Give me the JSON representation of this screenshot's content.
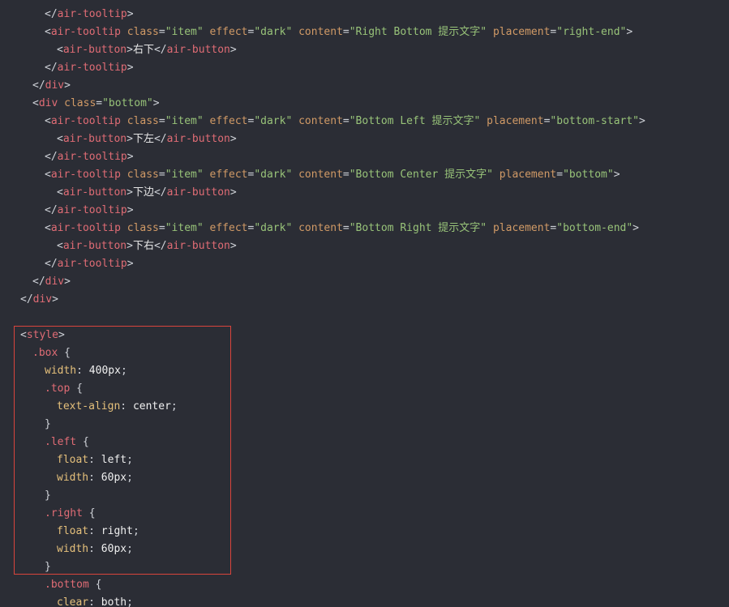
{
  "colors": {
    "background": "#2b2d35",
    "punct": "#cfd2d8",
    "tag": "#e06c75",
    "attr": "#d19a66",
    "string": "#98c379",
    "css_property": "#e5c07b",
    "highlight_border": "#d9443c"
  },
  "code": {
    "lines": [
      {
        "indent": 2,
        "tokens": [
          [
            "punct",
            "</"
          ],
          [
            "tag",
            "air-tooltip"
          ],
          [
            "punct",
            ">"
          ]
        ]
      },
      {
        "indent": 2,
        "tokens": [
          [
            "punct",
            "<"
          ],
          [
            "tag",
            "air-tooltip"
          ],
          [
            "plain",
            " "
          ],
          [
            "attr",
            "class"
          ],
          [
            "punct",
            "="
          ],
          [
            "str",
            "\"item\""
          ],
          [
            "plain",
            " "
          ],
          [
            "attr",
            "effect"
          ],
          [
            "punct",
            "="
          ],
          [
            "str",
            "\"dark\""
          ],
          [
            "plain",
            " "
          ],
          [
            "attr",
            "content"
          ],
          [
            "punct",
            "="
          ],
          [
            "str",
            "\"Right Bottom 提示文字\""
          ],
          [
            "plain",
            " "
          ],
          [
            "attr",
            "placement"
          ],
          [
            "punct",
            "="
          ],
          [
            "str",
            "\"right-end\""
          ],
          [
            "punct",
            ">"
          ]
        ]
      },
      {
        "indent": 3,
        "tokens": [
          [
            "punct",
            "<"
          ],
          [
            "tag",
            "air-button"
          ],
          [
            "punct",
            ">"
          ],
          [
            "text",
            "右下"
          ],
          [
            "punct",
            "</"
          ],
          [
            "tag",
            "air-button"
          ],
          [
            "punct",
            ">"
          ]
        ]
      },
      {
        "indent": 2,
        "tokens": [
          [
            "punct",
            "</"
          ],
          [
            "tag",
            "air-tooltip"
          ],
          [
            "punct",
            ">"
          ]
        ]
      },
      {
        "indent": 1,
        "tokens": [
          [
            "punct",
            "</"
          ],
          [
            "tag",
            "div"
          ],
          [
            "punct",
            ">"
          ]
        ]
      },
      {
        "indent": 1,
        "tokens": [
          [
            "punct",
            "<"
          ],
          [
            "tag",
            "div"
          ],
          [
            "plain",
            " "
          ],
          [
            "attr",
            "class"
          ],
          [
            "punct",
            "="
          ],
          [
            "str",
            "\"bottom\""
          ],
          [
            "punct",
            ">"
          ]
        ]
      },
      {
        "indent": 2,
        "tokens": [
          [
            "punct",
            "<"
          ],
          [
            "tag",
            "air-tooltip"
          ],
          [
            "plain",
            " "
          ],
          [
            "attr",
            "class"
          ],
          [
            "punct",
            "="
          ],
          [
            "str",
            "\"item\""
          ],
          [
            "plain",
            " "
          ],
          [
            "attr",
            "effect"
          ],
          [
            "punct",
            "="
          ],
          [
            "str",
            "\"dark\""
          ],
          [
            "plain",
            " "
          ],
          [
            "attr",
            "content"
          ],
          [
            "punct",
            "="
          ],
          [
            "str",
            "\"Bottom Left 提示文字\""
          ],
          [
            "plain",
            " "
          ],
          [
            "attr",
            "placement"
          ],
          [
            "punct",
            "="
          ],
          [
            "str",
            "\"bottom-start\""
          ],
          [
            "punct",
            ">"
          ]
        ]
      },
      {
        "indent": 3,
        "tokens": [
          [
            "punct",
            "<"
          ],
          [
            "tag",
            "air-button"
          ],
          [
            "punct",
            ">"
          ],
          [
            "text",
            "下左"
          ],
          [
            "punct",
            "</"
          ],
          [
            "tag",
            "air-button"
          ],
          [
            "punct",
            ">"
          ]
        ]
      },
      {
        "indent": 2,
        "tokens": [
          [
            "punct",
            "</"
          ],
          [
            "tag",
            "air-tooltip"
          ],
          [
            "punct",
            ">"
          ]
        ]
      },
      {
        "indent": 2,
        "tokens": [
          [
            "punct",
            "<"
          ],
          [
            "tag",
            "air-tooltip"
          ],
          [
            "plain",
            " "
          ],
          [
            "attr",
            "class"
          ],
          [
            "punct",
            "="
          ],
          [
            "str",
            "\"item\""
          ],
          [
            "plain",
            " "
          ],
          [
            "attr",
            "effect"
          ],
          [
            "punct",
            "="
          ],
          [
            "str",
            "\"dark\""
          ],
          [
            "plain",
            " "
          ],
          [
            "attr",
            "content"
          ],
          [
            "punct",
            "="
          ],
          [
            "str",
            "\"Bottom Center 提示文字\""
          ],
          [
            "plain",
            " "
          ],
          [
            "attr",
            "placement"
          ],
          [
            "punct",
            "="
          ],
          [
            "str",
            "\"bottom\""
          ],
          [
            "punct",
            ">"
          ]
        ]
      },
      {
        "indent": 3,
        "tokens": [
          [
            "punct",
            "<"
          ],
          [
            "tag",
            "air-button"
          ],
          [
            "punct",
            ">"
          ],
          [
            "text",
            "下边"
          ],
          [
            "punct",
            "</"
          ],
          [
            "tag",
            "air-button"
          ],
          [
            "punct",
            ">"
          ]
        ]
      },
      {
        "indent": 2,
        "tokens": [
          [
            "punct",
            "</"
          ],
          [
            "tag",
            "air-tooltip"
          ],
          [
            "punct",
            ">"
          ]
        ]
      },
      {
        "indent": 2,
        "tokens": [
          [
            "punct",
            "<"
          ],
          [
            "tag",
            "air-tooltip"
          ],
          [
            "plain",
            " "
          ],
          [
            "attr",
            "class"
          ],
          [
            "punct",
            "="
          ],
          [
            "str",
            "\"item\""
          ],
          [
            "plain",
            " "
          ],
          [
            "attr",
            "effect"
          ],
          [
            "punct",
            "="
          ],
          [
            "str",
            "\"dark\""
          ],
          [
            "plain",
            " "
          ],
          [
            "attr",
            "content"
          ],
          [
            "punct",
            "="
          ],
          [
            "str",
            "\"Bottom Right 提示文字\""
          ],
          [
            "plain",
            " "
          ],
          [
            "attr",
            "placement"
          ],
          [
            "punct",
            "="
          ],
          [
            "str",
            "\"bottom-end\""
          ],
          [
            "punct",
            ">"
          ]
        ]
      },
      {
        "indent": 3,
        "tokens": [
          [
            "punct",
            "<"
          ],
          [
            "tag",
            "air-button"
          ],
          [
            "punct",
            ">"
          ],
          [
            "text",
            "下右"
          ],
          [
            "punct",
            "</"
          ],
          [
            "tag",
            "air-button"
          ],
          [
            "punct",
            ">"
          ]
        ]
      },
      {
        "indent": 2,
        "tokens": [
          [
            "punct",
            "</"
          ],
          [
            "tag",
            "air-tooltip"
          ],
          [
            "punct",
            ">"
          ]
        ]
      },
      {
        "indent": 1,
        "tokens": [
          [
            "punct",
            "</"
          ],
          [
            "tag",
            "div"
          ],
          [
            "punct",
            ">"
          ]
        ]
      },
      {
        "indent": 0,
        "tokens": [
          [
            "punct",
            "</"
          ],
          [
            "tag",
            "div"
          ],
          [
            "punct",
            ">"
          ]
        ]
      },
      {
        "indent": 0,
        "tokens": []
      },
      {
        "indent": 0,
        "tokens": [
          [
            "punct",
            "<"
          ],
          [
            "tag",
            "style"
          ],
          [
            "punct",
            ">"
          ]
        ]
      },
      {
        "indent": 1,
        "tokens": [
          [
            "sel",
            ".box"
          ],
          [
            "punct",
            " {"
          ]
        ]
      },
      {
        "indent": 2,
        "tokens": [
          [
            "prop",
            "width"
          ],
          [
            "punct",
            ": "
          ],
          [
            "num",
            "400px"
          ],
          [
            "punct",
            ";"
          ]
        ]
      },
      {
        "indent": 2,
        "tokens": [
          [
            "sel",
            ".top"
          ],
          [
            "punct",
            " {"
          ]
        ]
      },
      {
        "indent": 3,
        "tokens": [
          [
            "prop",
            "text-align"
          ],
          [
            "punct",
            ": "
          ],
          [
            "plain",
            "center"
          ],
          [
            "punct",
            ";"
          ]
        ]
      },
      {
        "indent": 2,
        "tokens": [
          [
            "punct",
            "}"
          ]
        ]
      },
      {
        "indent": 2,
        "tokens": [
          [
            "sel",
            ".left"
          ],
          [
            "punct",
            " {"
          ]
        ]
      },
      {
        "indent": 3,
        "tokens": [
          [
            "prop",
            "float"
          ],
          [
            "punct",
            ": "
          ],
          [
            "plain",
            "left"
          ],
          [
            "punct",
            ";"
          ]
        ]
      },
      {
        "indent": 3,
        "tokens": [
          [
            "prop",
            "width"
          ],
          [
            "punct",
            ": "
          ],
          [
            "num",
            "60px"
          ],
          [
            "punct",
            ";"
          ]
        ]
      },
      {
        "indent": 2,
        "tokens": [
          [
            "punct",
            "}"
          ]
        ]
      },
      {
        "indent": 2,
        "tokens": [
          [
            "sel",
            ".right"
          ],
          [
            "punct",
            " {"
          ]
        ]
      },
      {
        "indent": 3,
        "tokens": [
          [
            "prop",
            "float"
          ],
          [
            "punct",
            ": "
          ],
          [
            "plain",
            "right"
          ],
          [
            "punct",
            ";"
          ]
        ]
      },
      {
        "indent": 3,
        "tokens": [
          [
            "prop",
            "width"
          ],
          [
            "punct",
            ": "
          ],
          [
            "num",
            "60px"
          ],
          [
            "punct",
            ";"
          ]
        ]
      },
      {
        "indent": 2,
        "tokens": [
          [
            "punct",
            "}"
          ]
        ]
      },
      {
        "indent": 2,
        "tokens": [
          [
            "sel",
            ".bottom"
          ],
          [
            "punct",
            " {"
          ]
        ]
      },
      {
        "indent": 3,
        "tokens": [
          [
            "prop",
            "clear"
          ],
          [
            "punct",
            ": "
          ],
          [
            "plain",
            "both"
          ],
          [
            "punct",
            ";"
          ]
        ]
      }
    ]
  }
}
